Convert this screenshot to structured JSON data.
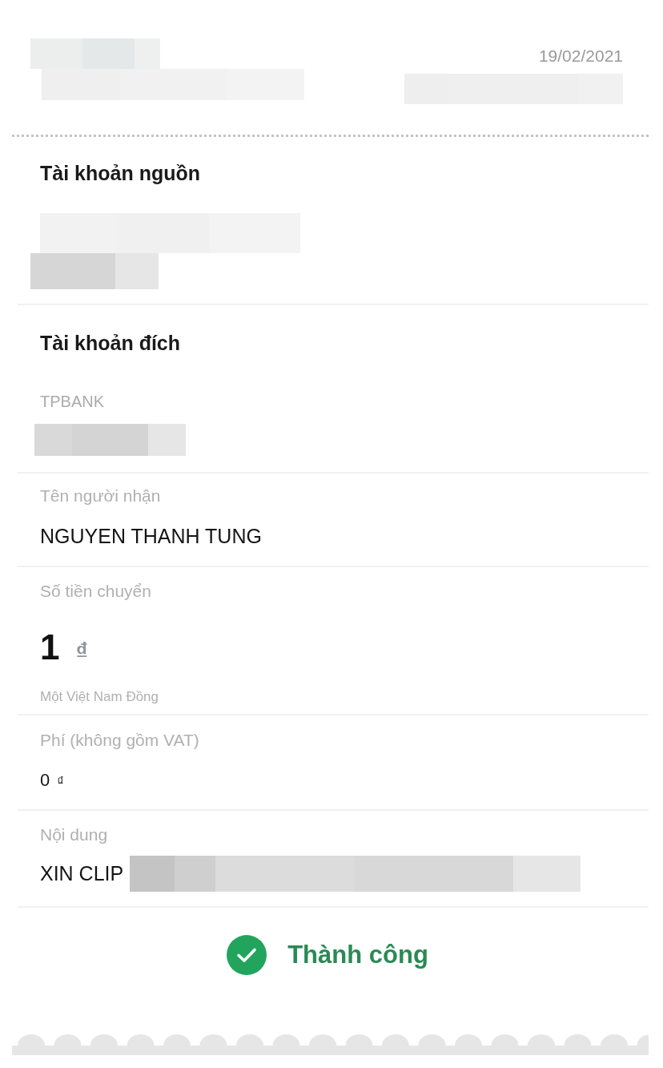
{
  "header": {
    "date": "19/02/2021"
  },
  "source_account": {
    "title": "Tài khoản nguồn"
  },
  "destination_account": {
    "title": "Tài khoản đích",
    "bank": "TPBANK"
  },
  "details": [
    {
      "kind": "text",
      "label": "Tên người nhận",
      "value": "NGUYEN THANH TUNG"
    },
    {
      "kind": "amount",
      "label": "Số tiền chuyển",
      "value": "1",
      "currency": "₫",
      "in_words": "Một Việt Nam Đồng"
    },
    {
      "kind": "money",
      "label": "Phí (không gồm VAT)",
      "value": "0",
      "currency": "₫"
    },
    {
      "kind": "note",
      "label": "Nội dung",
      "value": "XIN CLIP"
    }
  ],
  "status": {
    "kind": "success",
    "text": "Thành công"
  }
}
